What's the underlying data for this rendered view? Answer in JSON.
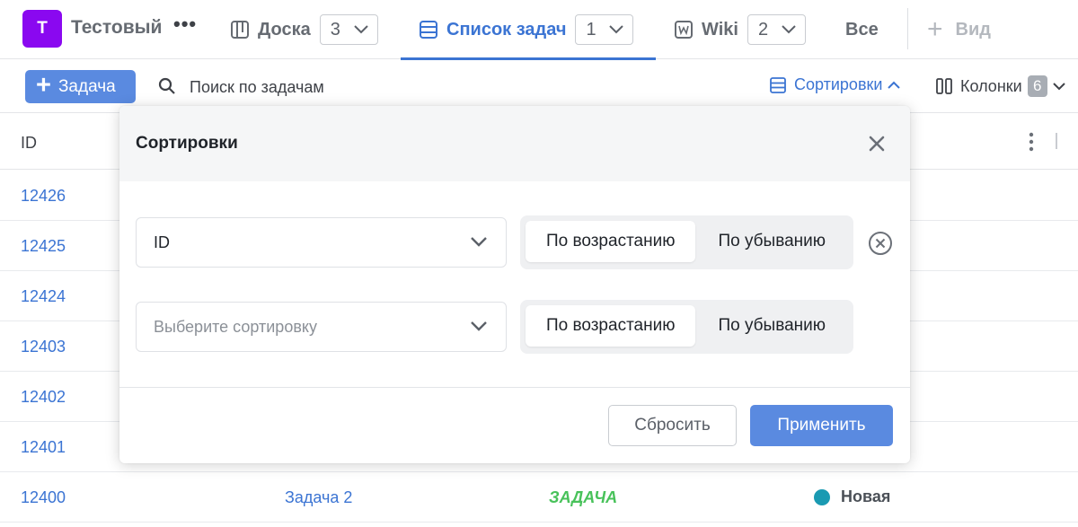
{
  "header": {
    "project": {
      "avatar_letter": "Т",
      "name": "Тестовый",
      "more": "•••"
    },
    "tabs": [
      {
        "id": "board",
        "label": "Доска",
        "count": "3",
        "active": false
      },
      {
        "id": "list",
        "label": "Список задач",
        "count": "1",
        "active": true
      },
      {
        "id": "wiki",
        "label": "Wiki",
        "count": "2",
        "active": false
      }
    ],
    "all_label": "Все",
    "add_view_label": "Вид"
  },
  "toolbar": {
    "add_task_label": "Задача",
    "search_placeholder": "Поиск по задачам",
    "sort_label": "Сортировки",
    "columns_label": "Колонки",
    "columns_count": "6"
  },
  "table": {
    "header_id": "ID",
    "rows": [
      {
        "id": "12426"
      },
      {
        "id": "12425"
      },
      {
        "id": "12424"
      },
      {
        "id": "12403"
      },
      {
        "id": "12402"
      },
      {
        "id": "12401"
      },
      {
        "id": "12400",
        "title": "Задача 2",
        "type": "ЗАДАЧА",
        "status": "Новая"
      }
    ]
  },
  "sort_modal": {
    "title": "Сортировки",
    "rows": [
      {
        "field_value": "ID",
        "asc_label": "По возрастанию",
        "desc_label": "По убыванию"
      },
      {
        "field_placeholder": "Выберите сортировку",
        "asc_label": "По возрастанию",
        "desc_label": "По убыванию"
      }
    ],
    "reset_label": "Сбросить",
    "apply_label": "Применить"
  },
  "colors": {
    "accent": "#3b74d3",
    "primary_button": "#5a8ae0",
    "project_avatar": "#8a08f0",
    "type_green": "#48c25a",
    "status_new": "#1a9ab2"
  }
}
